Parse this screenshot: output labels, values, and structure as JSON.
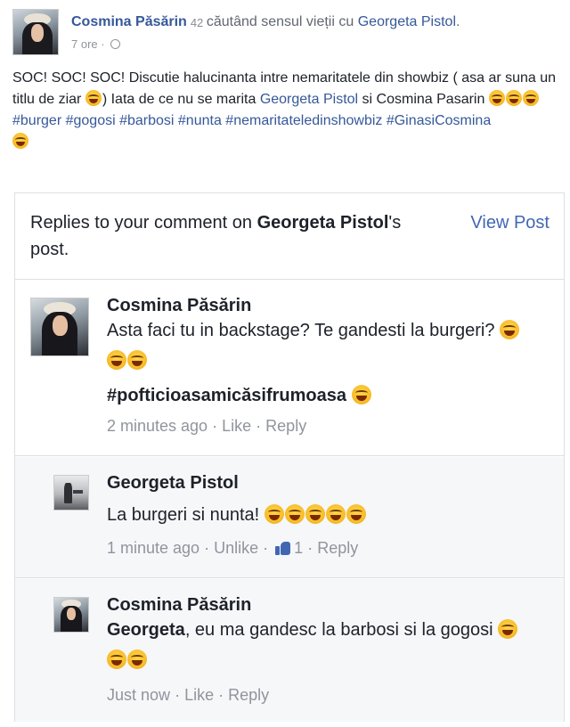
{
  "post": {
    "author": "Cosmina Păsărin",
    "verified_badge": "42",
    "feeling_text": "căutând sensul vieții cu",
    "tagged_person": "Georgeta Pistol",
    "tagged_suffix": ".",
    "time": "7 ore",
    "time_sep": "·",
    "text_part1": "SOC! SOC! SOC! Discutie halucinanta intre nemaritatele din showbiz ( asa ar suna un titlu de ziar",
    "text_part2": ") Iata de ce nu se marita",
    "text_link": "Georgeta Pistol",
    "text_part3": "si Cosmina Pasarin",
    "hashtags": "#burger #gogosi #barbosi #nunta #nemaritateledinshowbiz #GinasiCosmina"
  },
  "card": {
    "title_prefix": "Replies to your comment on ",
    "title_bold": "Georgeta Pistol",
    "title_suffix": "'s post.",
    "view_post": "View Post"
  },
  "comments": [
    {
      "name": "Cosmina Păsărin",
      "text": "Asta faci tu in backstage? Te gandesti la burgeri?",
      "tag": "#pofticioasamicăsifrumoasa",
      "time": "2 minutes ago",
      "like": "Like",
      "reply": "Reply",
      "sep": "·"
    },
    {
      "name": "Georgeta Pistol",
      "text": "La burgeri si nunta!",
      "time": "1 minute ago",
      "like": "Unlike",
      "like_count": "1",
      "reply": "Reply",
      "sep": "·"
    },
    {
      "name": "Cosmina Păsărin",
      "mention": "Georgeta",
      "text": ", eu ma gandesc la barbosi si la gogosi",
      "time": "Just now",
      "like": "Like",
      "reply": "Reply",
      "sep": "·"
    }
  ],
  "icons": {
    "emoji": "face-with-tears-of-joy-icon",
    "globe": "globe-icon",
    "like": "thumbs-up-icon",
    "badge": "verified-badge-icon"
  },
  "colors": {
    "link": "#365899",
    "accent": "#4267b2",
    "meta": "#90949c",
    "border": "#dddfe2",
    "reply_bg": "#f6f7f9"
  }
}
